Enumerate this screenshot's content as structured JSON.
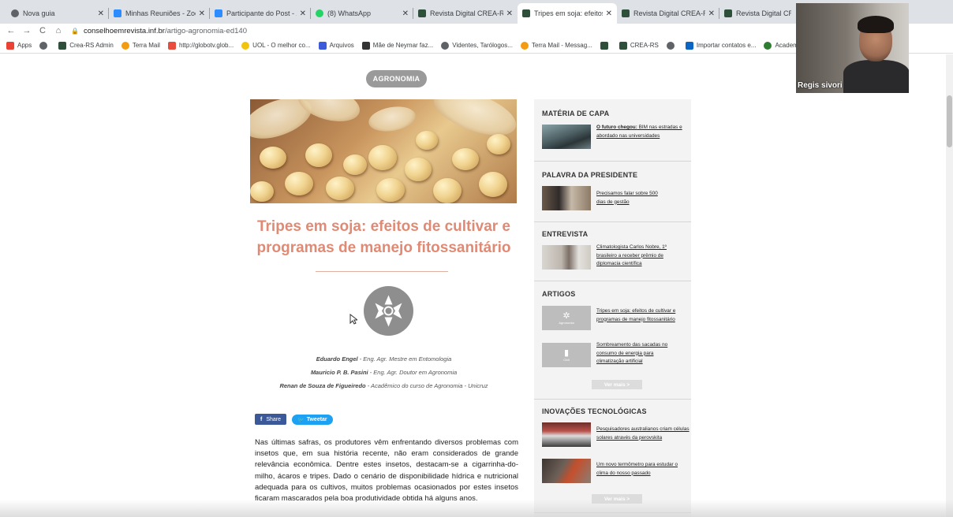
{
  "tabs": [
    {
      "title": "Nova guia",
      "fav_color": "#5f6368"
    },
    {
      "title": "Minhas Reuniões - Zoom",
      "fav_color": "#2d8cff"
    },
    {
      "title": "Participante do Post - Zoo",
      "fav_color": "#2d8cff"
    },
    {
      "title": "(8) WhatsApp",
      "fav_color": "#25d366"
    },
    {
      "title": "Revista Digital CREA-RS | c",
      "fav_color": "#2e4f3a"
    },
    {
      "title": "Tripes em soja: efeitos de c",
      "fav_color": "#2e4f3a"
    },
    {
      "title": "Revista Digital CREA-RS | c",
      "fav_color": "#2e4f3a"
    },
    {
      "title": "Revista Digital CREA-RS",
      "fav_color": "#2e4f3a"
    }
  ],
  "address": {
    "domain": "conselhoemrevista.inf.br",
    "path": "/artigo-agronomia-ed140"
  },
  "bookmarks": [
    {
      "label": "Apps",
      "color": "#ea4335"
    },
    {
      "label": "",
      "color": "#5f6368"
    },
    {
      "label": "Crea-RS Admin",
      "color": "#2e4f3a"
    },
    {
      "label": "Terra Mail",
      "color": "#f39c12"
    },
    {
      "label": "http://globotv.glob...",
      "color": "#e74c3c"
    },
    {
      "label": "UOL - O melhor co...",
      "color": "#f1c40f"
    },
    {
      "label": "Arquivos",
      "color": "#3b5bdb"
    },
    {
      "label": "Mãe de Neymar faz...",
      "color": "#333333"
    },
    {
      "label": "Videntes, Tarólogos...",
      "color": "#5f6368"
    },
    {
      "label": "Terra Mail - Messag...",
      "color": "#f39c12"
    },
    {
      "label": "",
      "color": "#2e4f3a"
    },
    {
      "label": "CREA-RS",
      "color": "#2e4f3a"
    },
    {
      "label": "",
      "color": "#5f6368"
    },
    {
      "label": "Importar contatos e...",
      "color": "#0a66c2"
    },
    {
      "label": "Academia Brasileira",
      "color": "#2e7d32"
    }
  ],
  "article": {
    "category": "AGRONOMIA",
    "title": "Tripes em soja: efeitos de cultivar e programas de manejo fitossanitário",
    "authors": [
      {
        "name": "Eduardo Engel",
        "desc": " - Eng. Agr. Mestre em Entomologia"
      },
      {
        "name": "Mauricio P. B. Pasini",
        "desc": " - Eng. Agr. Doutor em Agronomia"
      },
      {
        "name": "Renan de Souza de Figueiredo",
        "desc": " - Acadêmico do curso de Agronomia - Unicruz"
      }
    ],
    "share_label": "Share",
    "tweet_label": "Tweetar",
    "body": "Nas últimas safras, os produtores vêm enfrentando diversos problemas com insetos que, em sua história recente, não eram considerados de grande relevância econômica. Dentre estes insetos, destacam-se a cigarrinha-do-milho, ácaros e tripes. Dado o cenário de disponibilidade hídrica e nutricional adequada para os cultivos, muitos problemas ocasionados por estes insetos ficaram mascarados pela boa produtividade obtida há alguns anos."
  },
  "sidebar": {
    "capa": {
      "heading": "MATÉRIA DE CAPA",
      "bold": "O futuro chegou:",
      "text": " BIM nas estradas e abordado nas universidades"
    },
    "presidente": {
      "heading": "PALAVRA DA PRESIDENTE",
      "text": "Precisamos falar sobre 500 dias de gestão"
    },
    "entrevista": {
      "heading": "ENTREVISTA",
      "text": "Climatologista Carlos Nobre, 1º brasileiro a receber prêmio de diplomacia científica"
    },
    "artigos": {
      "heading": "ARTIGOS",
      "items": [
        {
          "text": "Tripes em soja: efeitos de cultivar e programas de manejo fitossanitário",
          "thumb_label": "Agronomia"
        },
        {
          "text": "Sombreamento das sacadas no consumo de energia para climatização artificial",
          "thumb_label": "Civil"
        }
      ],
      "more": "Ver mais  >"
    },
    "inovacoes": {
      "heading": "INOVAÇÕES TECNOLÓGICAS",
      "items": [
        {
          "text": "Pesquisadores australianos criam células solares através da perovskita"
        },
        {
          "text": "Um novo termômetro para estudar o clima do nosso passado"
        }
      ],
      "more": "Ver mais  >"
    }
  },
  "zoom": {
    "participant_name": "Regis sivori"
  }
}
